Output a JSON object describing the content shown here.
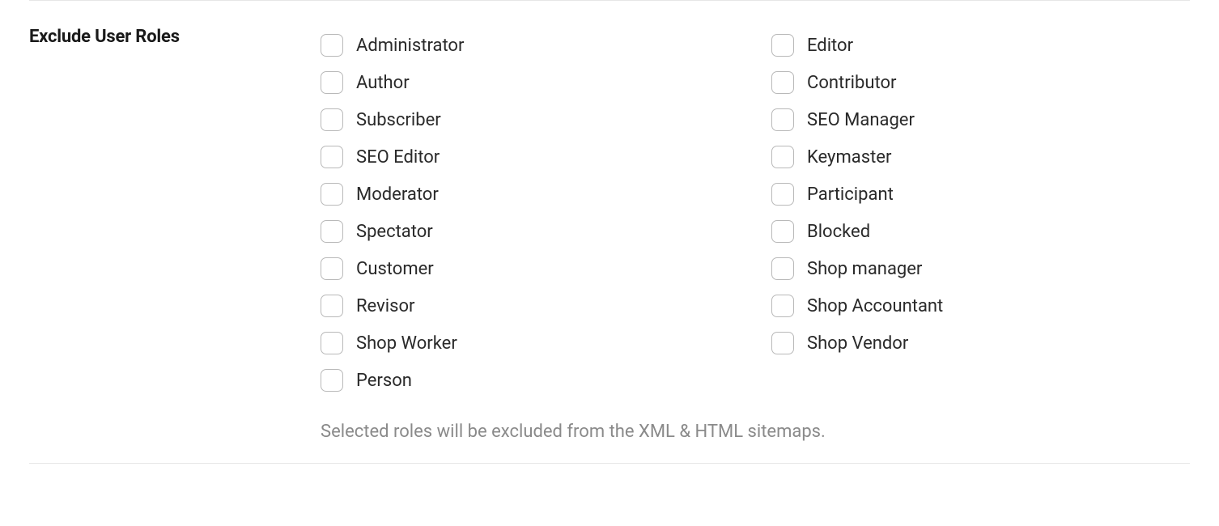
{
  "section": {
    "title": "Exclude User Roles",
    "helper": "Selected roles will be excluded from the XML & HTML sitemaps."
  },
  "roles": {
    "col1": [
      "Administrator",
      "Author",
      "Subscriber",
      "SEO Editor",
      "Moderator",
      "Spectator",
      "Customer",
      "Revisor",
      "Shop Worker",
      "Person"
    ],
    "col2": [
      "Editor",
      "Contributor",
      "SEO Manager",
      "Keymaster",
      "Participant",
      "Blocked",
      "Shop manager",
      "Shop Accountant",
      "Shop Vendor",
      ""
    ]
  }
}
